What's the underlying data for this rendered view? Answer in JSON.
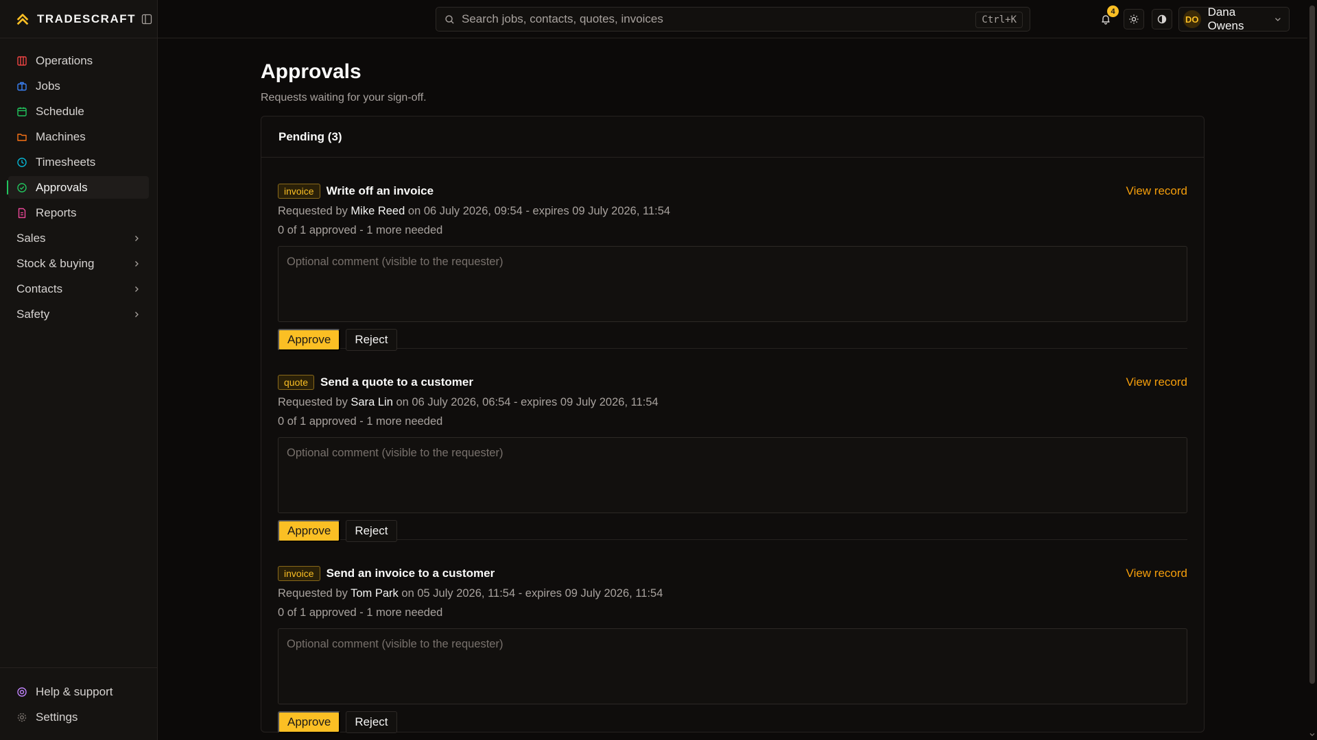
{
  "app": {
    "brand": "TRADESCRAFT"
  },
  "sidebar": {
    "items": [
      {
        "label": "Operations",
        "icon": "operations-icon",
        "color": "#ef4444"
      },
      {
        "label": "Jobs",
        "icon": "briefcase-icon",
        "color": "#3b82f6"
      },
      {
        "label": "Schedule",
        "icon": "calendar-icon",
        "color": "#22c55e"
      },
      {
        "label": "Machines",
        "icon": "folder-icon",
        "color": "#f97316"
      },
      {
        "label": "Timesheets",
        "icon": "clock-icon",
        "color": "#06b6d4"
      },
      {
        "label": "Approvals",
        "icon": "check-circle-icon",
        "color": "#22c55e",
        "active": true
      },
      {
        "label": "Reports",
        "icon": "report-icon",
        "color": "#ec4899"
      }
    ],
    "groups": [
      {
        "label": "Sales"
      },
      {
        "label": "Stock & buying"
      },
      {
        "label": "Contacts"
      },
      {
        "label": "Safety"
      }
    ],
    "bottom": [
      {
        "label": "Help & support",
        "icon": "lifebuoy-icon",
        "color": "#c084fc"
      },
      {
        "label": "Settings",
        "icon": "gear-icon",
        "color": "#78716c"
      }
    ]
  },
  "topbar": {
    "search_placeholder": "Search jobs, contacts, quotes, invoices",
    "shortcut": "Ctrl+K",
    "notification_count": "4",
    "user": {
      "initials": "DO",
      "name": "Dana Owens"
    }
  },
  "page": {
    "title": "Approvals",
    "subtitle": "Requests waiting for your sign-off."
  },
  "panel": {
    "header": "Pending (3)",
    "view_record_label": "View record",
    "comment_placeholder": "Optional comment (visible to the requester)",
    "approve_label": "Approve",
    "reject_label": "Reject",
    "requests": [
      {
        "tag": "invoice",
        "title": "Write off an invoice",
        "requested_by_prefix": "Requested by",
        "requester": "Mike Reed",
        "details": "on 06 July 2026, 09:54 - expires 09 July 2026, 11:54",
        "progress": "0 of 1 approved - 1 more needed"
      },
      {
        "tag": "quote",
        "title": "Send a quote to a customer",
        "requested_by_prefix": "Requested by",
        "requester": "Sara Lin",
        "details": "on 06 July 2026, 06:54 - expires 09 July 2026, 11:54",
        "progress": "0 of 1 approved - 1 more needed"
      },
      {
        "tag": "invoice",
        "title": "Send an invoice to a customer",
        "requested_by_prefix": "Requested by",
        "requester": "Tom Park",
        "details": "on 05 July 2026, 11:54 - expires 09 July 2026, 11:54",
        "progress": "0 of 1 approved - 1 more needed"
      }
    ]
  },
  "colors": {
    "accent": "#fbbf24",
    "link": "#f59e0b",
    "active_indicator": "#22c55e",
    "background": "#0c0a09"
  }
}
